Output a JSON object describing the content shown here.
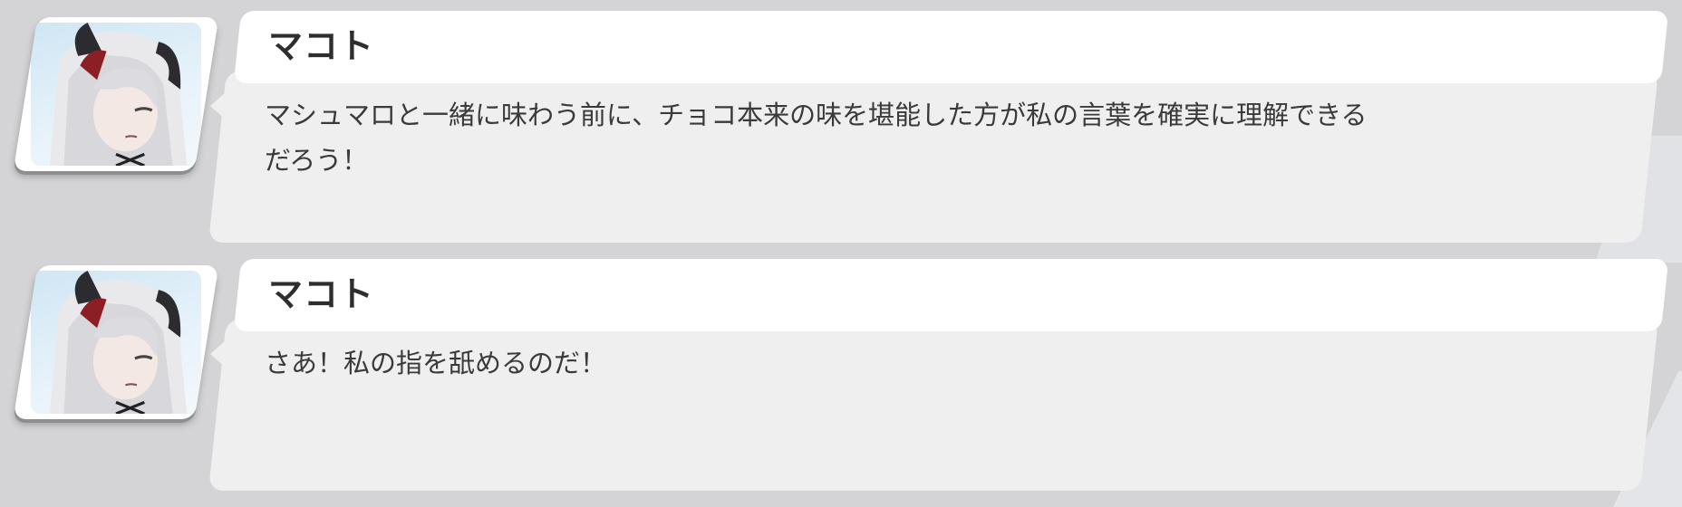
{
  "messages": [
    {
      "speaker": "マコト",
      "text": "マシュマロと一緒に味わう前に、チョコ本来の味を堪能した方が私の言葉を確実に理解できる\nだろう！",
      "avatar_icon": "character-portrait"
    },
    {
      "speaker": "マコト",
      "text": "さあ！私の指を舐めるのだ！",
      "avatar_icon": "character-portrait"
    }
  ],
  "colors": {
    "background": "#d4d4d6",
    "name_tab": "#ffffff",
    "text_panel": "#efefef",
    "name_text": "#2e2e30",
    "body_text": "#3a3a3c"
  }
}
